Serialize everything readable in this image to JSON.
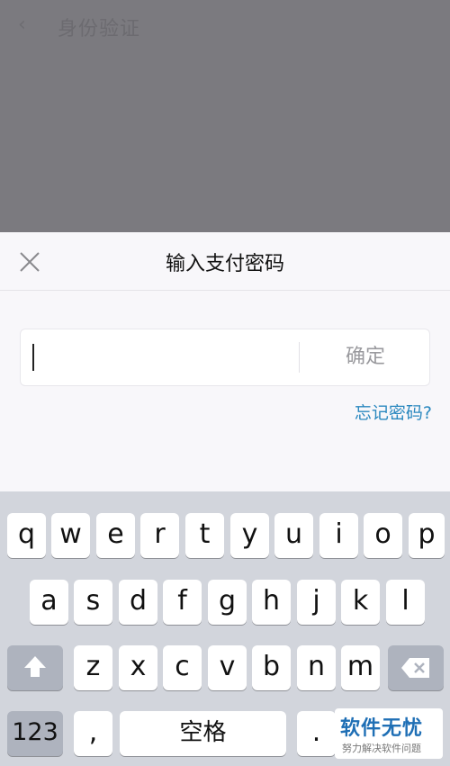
{
  "background": {
    "title": "身份验证"
  },
  "dialog": {
    "title": "输入支付密码",
    "confirm_label": "确定",
    "forgot_label": "忘记密码?"
  },
  "keyboard": {
    "row1": [
      "q",
      "w",
      "e",
      "r",
      "t",
      "y",
      "u",
      "i",
      "o",
      "p"
    ],
    "row2": [
      "a",
      "s",
      "d",
      "f",
      "g",
      "h",
      "j",
      "k",
      "l"
    ],
    "row3": [
      "z",
      "x",
      "c",
      "v",
      "b",
      "n",
      "m"
    ],
    "num_label": "123",
    "comma_label": ",",
    "space_label": "空格",
    "period_label": "."
  },
  "watermark": {
    "title": "软件无忧",
    "subtitle": "努力解决软件问题"
  }
}
